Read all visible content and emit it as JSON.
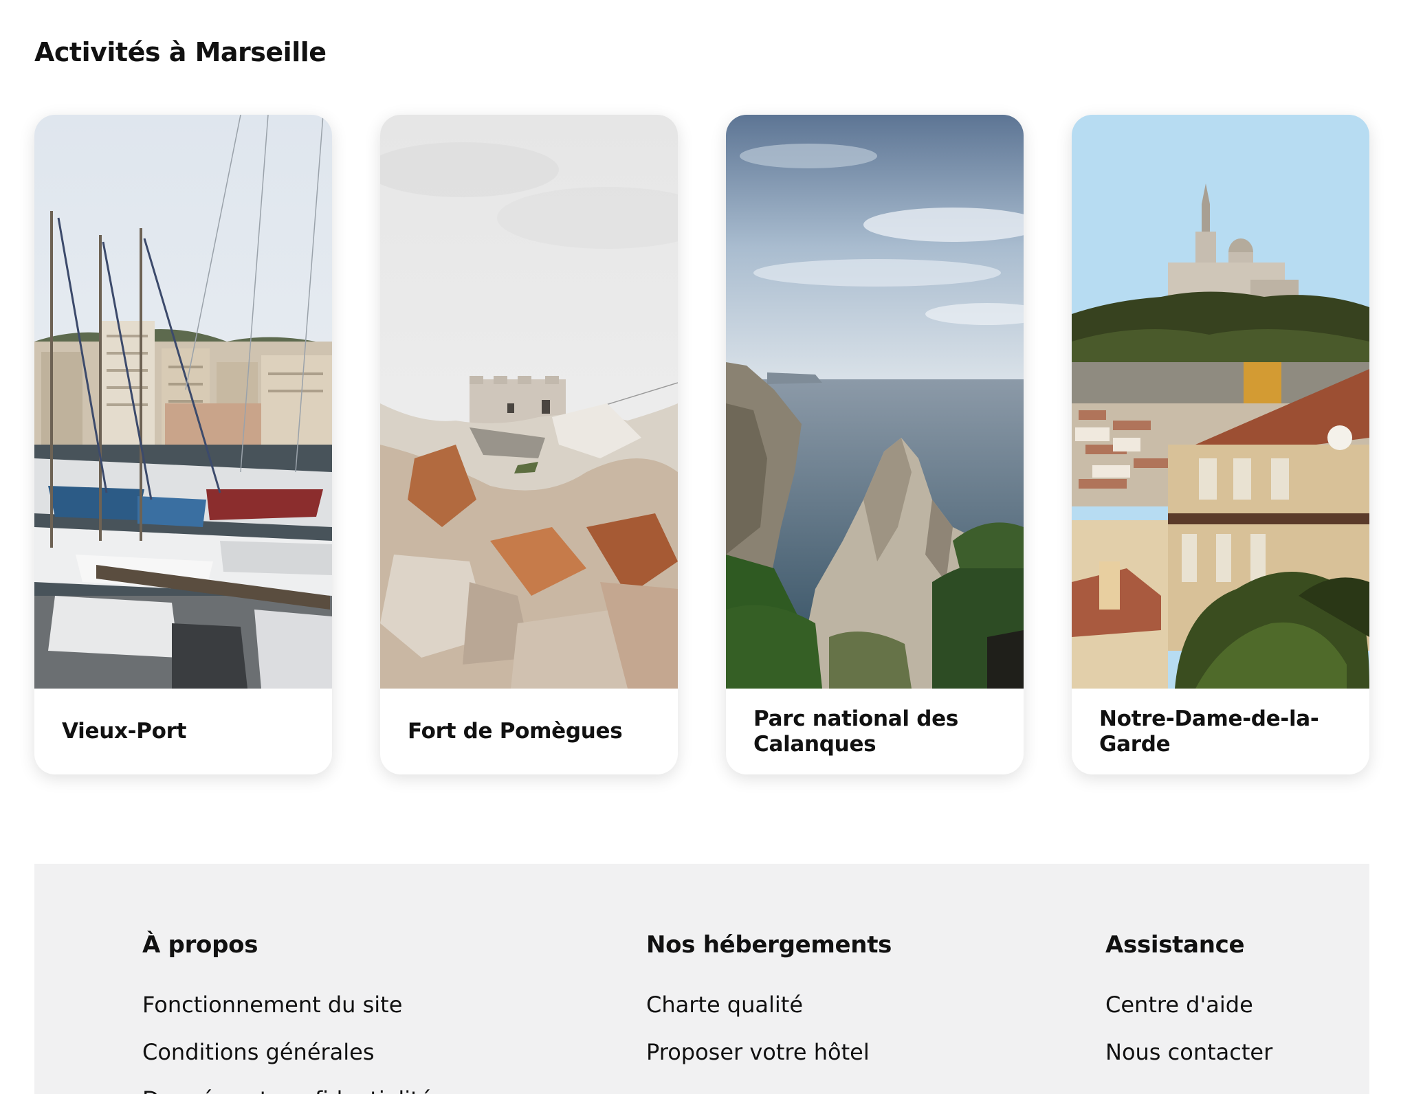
{
  "section": {
    "title": "Activités à Marseille"
  },
  "cards": [
    {
      "title": "Vieux-Port"
    },
    {
      "title": "Fort de Pomègues"
    },
    {
      "title": "Parc national des Calanques"
    },
    {
      "title": "Notre-Dame-de-la-Garde"
    }
  ],
  "footer": {
    "columns": [
      {
        "heading": "À propos",
        "links": [
          "Fonctionnement du site",
          "Conditions générales",
          "Données et confidentialité"
        ]
      },
      {
        "heading": "Nos hébergements",
        "links": [
          "Charte qualité",
          "Proposer votre hôtel"
        ]
      },
      {
        "heading": "Assistance",
        "links": [
          "Centre d'aide",
          "Nous contacter"
        ]
      }
    ]
  },
  "colors": {
    "footer_background": "#f1f1f2",
    "text": "#111111"
  }
}
